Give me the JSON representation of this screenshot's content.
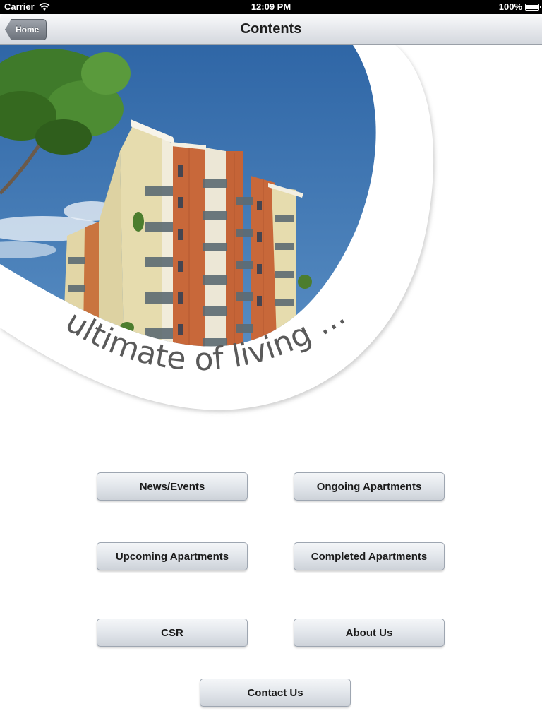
{
  "status_bar": {
    "carrier": "Carrier",
    "time": "12:09 PM",
    "battery": "100%",
    "icons": [
      "wifi-icon",
      "battery-icon"
    ]
  },
  "nav_bar": {
    "title": "Contents",
    "back_label": "Home"
  },
  "hero": {
    "tagline": "ultimate of living ..."
  },
  "menu": {
    "news_events": "News/Events",
    "ongoing": "Ongoing Apartments",
    "upcoming": "Upcoming Apartments",
    "completed": "Completed Apartments",
    "csr": "CSR",
    "about": "About Us",
    "contact": "Contact Us"
  },
  "colors": {
    "sky": "#3a72b0",
    "brick": "#c8683a",
    "button_text": "#1b1b1b",
    "nav_title": "#1e1e1e"
  }
}
